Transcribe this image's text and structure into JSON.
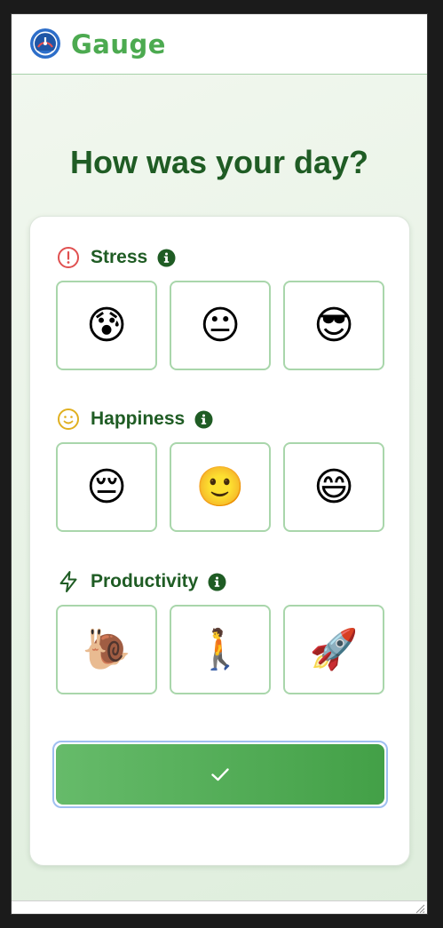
{
  "app": {
    "name": "Gauge",
    "brand_color": "#4caa50",
    "title_color": "#1f5c24"
  },
  "page": {
    "title": "How was your day?"
  },
  "sections": [
    {
      "label": "Stress",
      "icon": "alert-circle-icon",
      "icon_color": "#e05050",
      "options": [
        "😰",
        "😐",
        "😎"
      ]
    },
    {
      "label": "Happiness",
      "icon": "smile-icon",
      "icon_color": "#e0b020",
      "options": [
        "😔",
        "🙂",
        "😄"
      ]
    },
    {
      "label": "Productivity",
      "icon": "lightning-icon",
      "icon_color": "#1f5c24",
      "options": [
        "🐌",
        "🚶",
        "🚀"
      ]
    }
  ],
  "submit": {
    "icon": "check-icon"
  }
}
